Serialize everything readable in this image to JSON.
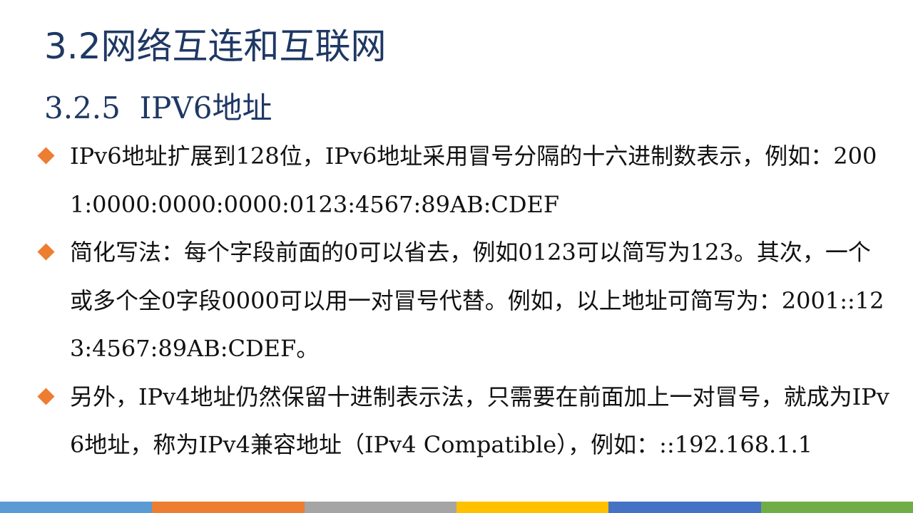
{
  "slide": {
    "title": "3.2网络互连和互联网",
    "subtitle": "3.2.5  IPV6地址",
    "bullets": [
      {
        "text": "IPv6地址扩展到128位，IPv6地址采用冒号分隔的十六进制数表示，例如：2001:0000:0000:0000:0123:4567:89AB:CDEF"
      },
      {
        "text": "简化写法：每个字段前面的0可以省去，例如0123可以简写为123。其次，一个或多个全0字段0000可以用一对冒号代替。例如，以上地址可简写为：2001::123:4567:89AB:CDEF。"
      },
      {
        "text": "另外，IPv4地址仍然保留十进制表示法，只需要在前面加上一对冒号，就成为IPv6地址，称为IPv4兼容地址（IPv4 Compatible），例如：::192.168.1.1"
      }
    ]
  },
  "colors": {
    "title": "#1f3864",
    "bullet_marker": "#ed7d31",
    "text": "#111111",
    "bottom_bar": [
      "#5b9bd5",
      "#ed7d31",
      "#a5a5a5",
      "#ffc000",
      "#4472c4",
      "#70ad47"
    ]
  },
  "icons": {
    "bullet": "orange-diamond-icon"
  }
}
